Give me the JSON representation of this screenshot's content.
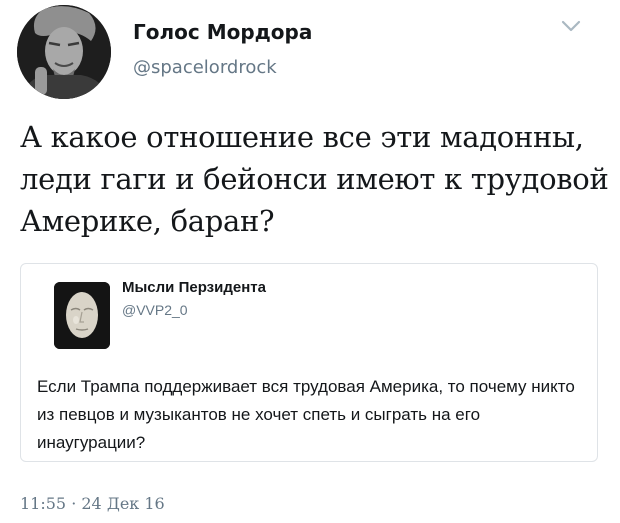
{
  "tweet": {
    "display_name": "Голос Мордора",
    "handle": "@spacelordrock",
    "text": "А какое отношение все эти мадонны, леди гаги и бейонси имеют к трудовой Америке, баран?",
    "timestamp": "11:55 · 24 Дек 16",
    "menu_icon": "chevron-down-icon"
  },
  "quoted": {
    "display_name": "Мысли Перзидента",
    "handle": "@VVP2_0",
    "text": "Если Трампа поддерживает вся трудовая Америка, то почему никто из певцов и музыкантов не хочет спеть и сыграть на его инаугурации?"
  },
  "colors": {
    "text": "#14171a",
    "secondary": "#657786",
    "border": "#dfe3e7"
  }
}
